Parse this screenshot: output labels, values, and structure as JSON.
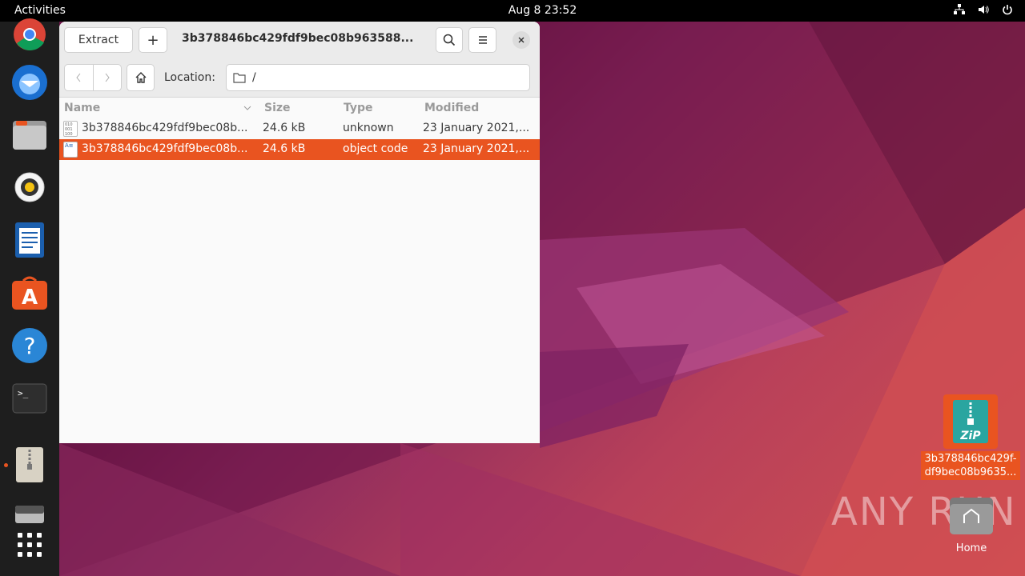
{
  "topbar": {
    "activities": "Activities",
    "clock": "Aug 8  23:52",
    "tray_icons": [
      "network-icon",
      "volume-icon",
      "power-icon"
    ]
  },
  "dock": {
    "items": [
      {
        "name": "chrome",
        "icon": "chrome-icon"
      },
      {
        "name": "thunderbird",
        "icon": "thunderbird-icon"
      },
      {
        "name": "files",
        "icon": "folder-icon"
      },
      {
        "name": "rhythmbox",
        "icon": "rhythmbox-icon"
      },
      {
        "name": "writer",
        "icon": "writer-icon"
      },
      {
        "name": "software",
        "icon": "app-center-icon"
      },
      {
        "name": "help",
        "icon": "help-icon"
      },
      {
        "name": "terminal",
        "icon": "terminal-icon"
      },
      {
        "name": "archive-manager",
        "icon": "archive-icon",
        "running": true
      },
      {
        "name": "drive",
        "icon": "drive-icon"
      },
      {
        "name": "show-apps",
        "icon": "app-grid-icon"
      }
    ]
  },
  "window": {
    "extract_label": "Extract",
    "add_label": "+",
    "title": "3b378846bc429fdf9bec08b963588...",
    "location_label": "Location:",
    "location_value": "/",
    "columns": {
      "name": "Name",
      "size": "Size",
      "type": "Type",
      "modified": "Modified"
    },
    "rows": [
      {
        "name": "3b378846bc429fdf9bec08b...",
        "size": "24.6 kB",
        "type": "unknown",
        "modified": "23 January 2021,...",
        "selected": false,
        "icon": "binary-file-icon"
      },
      {
        "name": "3b378846bc429fdf9bec08b...",
        "size": "24.6 kB",
        "type": "object code",
        "modified": "23 January 2021,...",
        "selected": true,
        "icon": "object-file-icon"
      }
    ]
  },
  "desktop": {
    "zip_label": "3b378846bc429f-df9bec08b9635...",
    "home_label": "Home",
    "watermark": "ANY RUN"
  },
  "colors": {
    "accent": "#e95420",
    "dock": "#1e1e1e",
    "topbar": "#000000"
  }
}
